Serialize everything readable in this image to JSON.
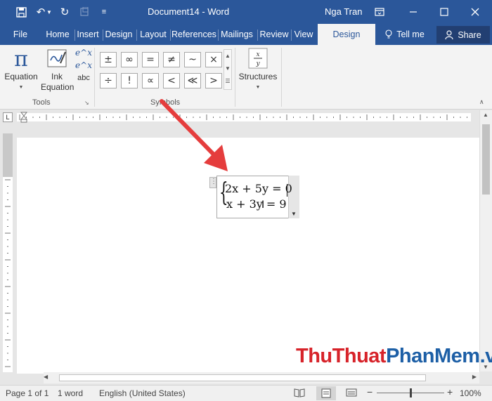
{
  "titlebar": {
    "title": "Document14 - Word",
    "user": "Nga Tran",
    "undo_glyph": "↶",
    "redo_glyph": "↻",
    "customize_glyph": "≡",
    "color": "#2b579a"
  },
  "tabs": [
    {
      "label": "File"
    },
    {
      "label": "Home"
    },
    {
      "label": "Insert"
    },
    {
      "label": "Design"
    },
    {
      "label": "Layout"
    },
    {
      "label": "References"
    },
    {
      "label": "Mailings"
    },
    {
      "label": "Review"
    },
    {
      "label": "View"
    },
    {
      "label": "Design",
      "active": true
    },
    {
      "label": "Tell me"
    }
  ],
  "share_label": "Share",
  "ribbon": {
    "equation": {
      "icon": "π",
      "label": "Equation"
    },
    "ink": {
      "label1": "Ink",
      "label2": "Equation"
    },
    "abc": "abc",
    "tools_label": "Tools",
    "symbols_label": "Symbols",
    "symbols": [
      "±",
      "∞",
      "=",
      "≠",
      "~",
      "×",
      "÷",
      "!",
      "∝",
      "<",
      "≪",
      ">"
    ],
    "structures_label": "Structures"
  },
  "equation": {
    "line1": "2x + 5y = 0",
    "line2": "x + 3y = 9"
  },
  "status": {
    "page": "Page 1 of 1",
    "words": "1 word",
    "language": "English (United States)",
    "zoom": "100%",
    "minus": "−",
    "plus": "+"
  },
  "watermark": {
    "part1": "Thu",
    "part2": "Thuat",
    "part3": "PhanMem",
    "part4": ".vn",
    "color_red": "#d7232a",
    "color_blue": "#1d5fa6"
  }
}
